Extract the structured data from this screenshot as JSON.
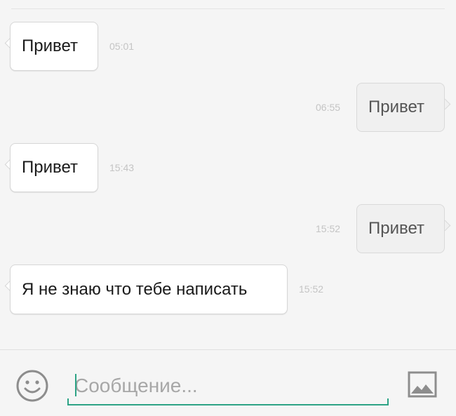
{
  "messages": [
    {
      "direction": "incoming",
      "text": "Привет",
      "time": "05:01"
    },
    {
      "direction": "outgoing",
      "text": "Привет",
      "time": "06:55"
    },
    {
      "direction": "incoming",
      "text": "Привет",
      "time": "15:43"
    },
    {
      "direction": "outgoing",
      "text": "Привет",
      "time": "15:52"
    },
    {
      "direction": "incoming",
      "text": "Я не знаю что тебе написать",
      "time": "15:52"
    }
  ],
  "composer": {
    "placeholder": "Сообщение...",
    "value": "",
    "accent_color": "#2da385"
  },
  "icons": {
    "emoji": "smiley-face-icon",
    "attach_image": "image-icon"
  }
}
